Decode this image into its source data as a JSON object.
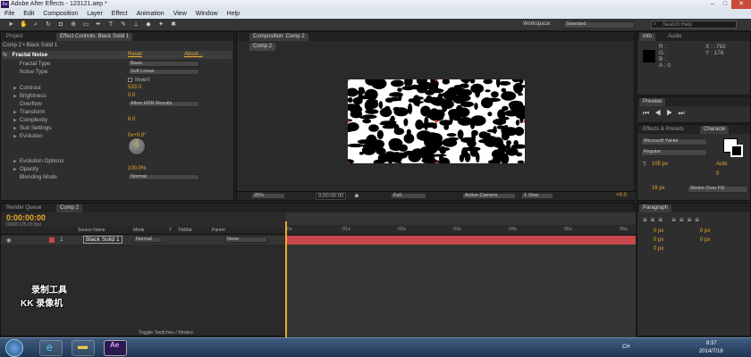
{
  "window": {
    "title": "Adobe After Effects - 123121.aep *",
    "app_badge": "Ae"
  },
  "menu": [
    "File",
    "Edit",
    "Composition",
    "Layer",
    "Effect",
    "Animation",
    "View",
    "Window",
    "Help"
  ],
  "toolbar": {
    "workspace_label": "Workspace:",
    "workspace_value": "Standard",
    "search_placeholder": "Search Help"
  },
  "project_panel": {
    "tab_project": "Project",
    "tab_effect_controls": "Effect Controls: Black Solid 1",
    "breadcrumb": "Comp 2 • Black Solid 1",
    "effect_name": "Fractal Noise",
    "reset": "Reset",
    "about": "About...",
    "props": [
      {
        "label": "Fractal Type",
        "value": "Basic",
        "kind": "dropdown"
      },
      {
        "label": "Noise Type",
        "value": "Soft Linear",
        "kind": "dropdown"
      },
      {
        "label": "",
        "value": "Invert",
        "kind": "checkbox"
      },
      {
        "label": "Contrast",
        "value": "533.0",
        "kind": "number"
      },
      {
        "label": "Brightness",
        "value": "0.0",
        "kind": "number"
      },
      {
        "label": "Overflow",
        "value": "Allow HDR Results",
        "kind": "dropdown"
      },
      {
        "label": "Transform",
        "value": "",
        "kind": "group"
      },
      {
        "label": "Complexity",
        "value": "6.0",
        "kind": "number"
      },
      {
        "label": "Sub Settings",
        "value": "",
        "kind": "group"
      },
      {
        "label": "Evolution",
        "value": "0x+0.0°",
        "kind": "number"
      }
    ],
    "props2": [
      {
        "label": "Evolution Options",
        "value": "",
        "kind": "group"
      },
      {
        "label": "Opacity",
        "value": "100.0%",
        "kind": "number"
      },
      {
        "label": "Blending Mode",
        "value": "Normal",
        "kind": "dropdown"
      }
    ]
  },
  "comp_panel": {
    "tab": "Composition: Comp 2",
    "sub_tab": "Comp 2",
    "zoom": "25%",
    "timecode": "0:00:00:00",
    "resolution": "Full",
    "camera": "Active Camera",
    "views": "1 View",
    "offset": "+0.0"
  },
  "info_panel": {
    "tab_info": "Info",
    "tab_audio": "Audio",
    "r": "R :",
    "g": "G :",
    "b": "B :",
    "a": "A : 0",
    "x": "X : -792",
    "y": "Y : 176"
  },
  "preview_panel": {
    "tab": "Preview"
  },
  "effects_panel": {
    "tab_effects": "Effects & Presets",
    "tab_character": "Characte",
    "font": "Microsoft YaHei",
    "style": "Regular",
    "size": "105 px",
    "leading": "Auto",
    "tracking": "0",
    "stroke": "16 px",
    "stroke_mode": "Stroke Over Fill"
  },
  "paragraph_panel": {
    "tab": "Paragraph",
    "indent_values": [
      "0 px",
      "0 px",
      "0 px",
      "0 px",
      "0 px"
    ]
  },
  "timeline": {
    "tab_render": "Render Queue",
    "timecode": "0:00:00:00",
    "fps": "00000 (25.00 fps)",
    "comp_tab": "Comp 2",
    "headers": {
      "source": "Source Name",
      "mode": "Mode",
      "t": "T",
      "trkmat": "TrkMat",
      "parent": "Parent"
    },
    "layer": {
      "num": "1",
      "name": "Black Solid 1",
      "mode": "Normal",
      "parent": "None"
    },
    "ruler": [
      "0s",
      "01s",
      "02s",
      "03s",
      "04s",
      "05s",
      "06s"
    ],
    "toggle": "Toggle Switches / Modes"
  },
  "watermark": {
    "line1": "录制工具",
    "line2": "KK 录像机"
  },
  "taskbar": {
    "time": "8:37",
    "date": "2014/7/18",
    "lang": "CH"
  },
  "colors": {
    "accent": "#e8a828",
    "layer_bar": "#c7484a",
    "timecode": "#e8a828"
  }
}
